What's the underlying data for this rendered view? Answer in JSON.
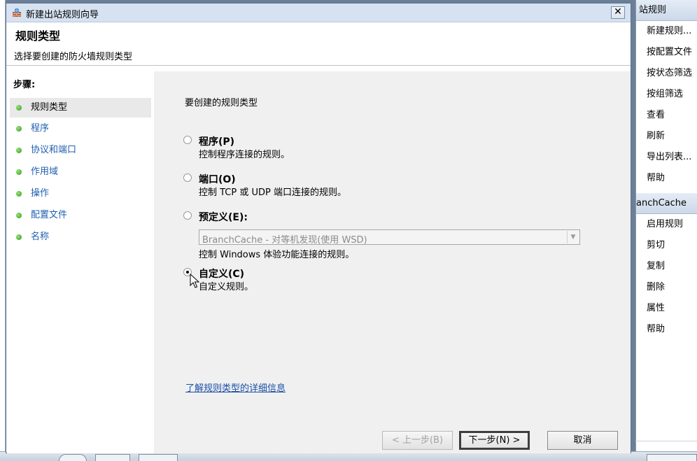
{
  "wizard": {
    "title": "新建出站规则向导",
    "page_title": "规则类型",
    "page_subtitle": "选择要创建的防火墙规则类型"
  },
  "steps": {
    "heading": "步骤:",
    "items": [
      {
        "label": "规则类型",
        "state": "active"
      },
      {
        "label": "程序",
        "state": "pending"
      },
      {
        "label": "协议和端口",
        "state": "pending"
      },
      {
        "label": "作用域",
        "state": "pending"
      },
      {
        "label": "操作",
        "state": "pending"
      },
      {
        "label": "配置文件",
        "state": "pending"
      },
      {
        "label": "名称",
        "state": "pending"
      }
    ]
  },
  "content": {
    "prompt": "要创建的规则类型",
    "options": [
      {
        "label": "程序(P)",
        "description": "控制程序连接的规则。",
        "selected": false
      },
      {
        "label": "端口(O)",
        "description": "控制 TCP 或 UDP 端口连接的规则。",
        "selected": false
      },
      {
        "label": "预定义(E):",
        "description": "控制 Windows 体验功能连接的规则。",
        "selected": false
      },
      {
        "label": "自定义(C)",
        "description": "自定义规则。",
        "selected": true
      }
    ],
    "predefined_select_value": "BranchCache - 对等机发现(使用 WSD)",
    "learn_more_link": "了解规则类型的详细信息"
  },
  "buttons": {
    "back": "< 上一步(B)",
    "next": "下一步(N) >",
    "cancel": "取消"
  },
  "actions_pane": {
    "header1": "站规则",
    "section1_items": [
      "新建规则...",
      "按配置文件",
      "按状态筛选",
      "按组筛选",
      "查看",
      "刷新",
      "导出列表...",
      "帮助"
    ],
    "header2": "anchCache",
    "section2_items": [
      "启用规则",
      "剪切",
      "复制",
      "删除",
      "属性",
      "帮助"
    ]
  },
  "colors": {
    "link": "#1a4ea6",
    "step_pending": "#1f5fb0",
    "step_dot": "#2f9a1c",
    "title_bar": "#d6e2f1"
  }
}
